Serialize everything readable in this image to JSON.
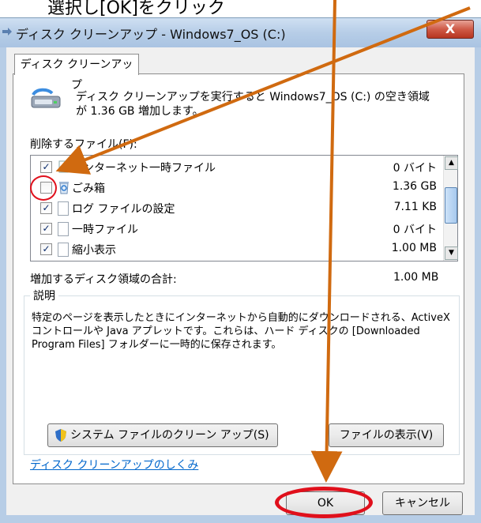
{
  "window": {
    "title": "ディスク クリーンアップ - Windows7_OS (C:)",
    "close_label": "X"
  },
  "tab": {
    "label": "ディスク クリーンアップ"
  },
  "intro": {
    "text1": "ディスク クリーンアップを実行すると Windows7_OS (C:) の空き領域",
    "text2": "が 1.36 GB 増加します。"
  },
  "files_label": "削除するファイル(F):",
  "files": [
    {
      "label": "インターネット一時ファイル",
      "size": "0 バイト",
      "checked": true,
      "icon": "internet-files-icon"
    },
    {
      "label": "ごみ箱",
      "size": "1.36 GB",
      "checked": false,
      "icon": "recycle-bin-icon"
    },
    {
      "label": "ログ ファイルの設定",
      "size": "7.11 KB",
      "checked": true,
      "icon": "file-icon"
    },
    {
      "label": "一時ファイル",
      "size": "0 バイト",
      "checked": true,
      "icon": "file-icon"
    },
    {
      "label": "縮小表示",
      "size": "1.00 MB",
      "checked": true,
      "icon": "file-icon"
    }
  ],
  "total": {
    "label": "増加するディスク領域の合計:",
    "value": "1.00 MB"
  },
  "description": {
    "legend": "説明",
    "text": "特定のページを表示したときにインターネットから自動的にダウンロードされる、ActiveX コントロールや Java アプレットです。これらは、ハード ディスクの [Downloaded Program Files] フォルダーに一時的に保存されます。"
  },
  "buttons": {
    "system_cleanup": "システム ファイルのクリーン アップ(S)",
    "view_files": "ファイルの表示(V)",
    "ok": "OK",
    "cancel": "キャンセル"
  },
  "link": "ディスク クリーンアップのしくみ",
  "caption_partial": "選択し[OK]をクリック",
  "colors": {
    "annotation_red": "#e0101c",
    "annotation_orange": "#d06a10"
  }
}
